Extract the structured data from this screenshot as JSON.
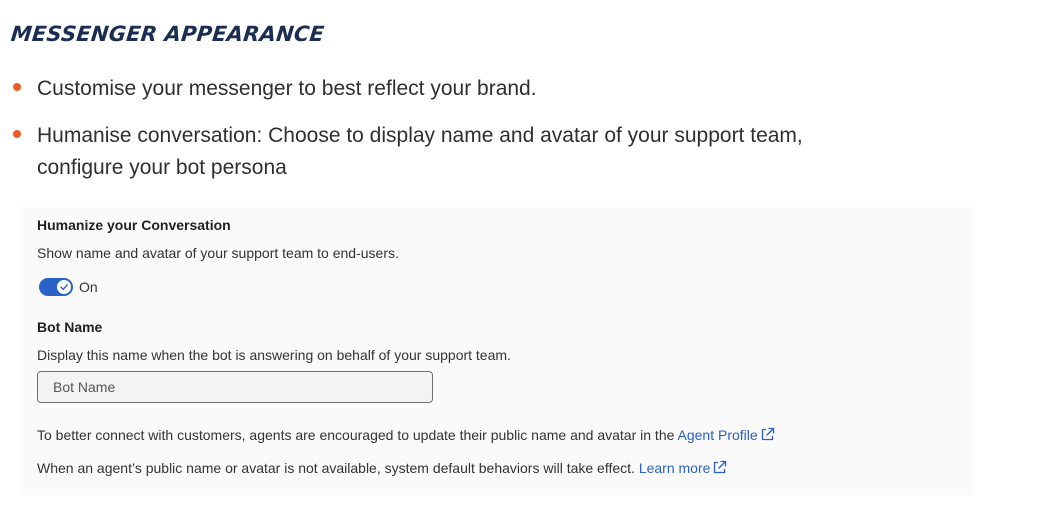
{
  "section": {
    "title": "MESSENGER APPEARANCE"
  },
  "bullets": [
    {
      "text": "Customise your messenger to best reflect your brand."
    },
    {
      "text": "Humanise conversation: Choose to display name and avatar of your support team, configure your bot persona"
    }
  ],
  "panel": {
    "humanize": {
      "heading": "Humanize your Conversation",
      "description": "Show name and avatar of your support team to end-users.",
      "toggle_label": "On",
      "toggle_state": true,
      "toggle_color": "#2a63c7"
    },
    "bot_name": {
      "heading": "Bot Name",
      "description": "Display this name when the bot is answering on behalf of your support team.",
      "input_placeholder": "Bot Name",
      "input_value": ""
    },
    "notes": {
      "agent_profile_text": "To better connect with customers, agents are encouraged to update their public name and avatar in the",
      "agent_profile_link": "Agent Profile",
      "default_behavior_text": "When an agent’s public name or avatar is not available, system default behaviors will take effect.",
      "learn_more_link": "Learn more",
      "link_icon": "external-link-icon"
    }
  },
  "colors": {
    "title": "#1b2d52",
    "bullet": "#f05a28",
    "link": "#2a5fc7",
    "panel_bg": "#fafafa"
  }
}
